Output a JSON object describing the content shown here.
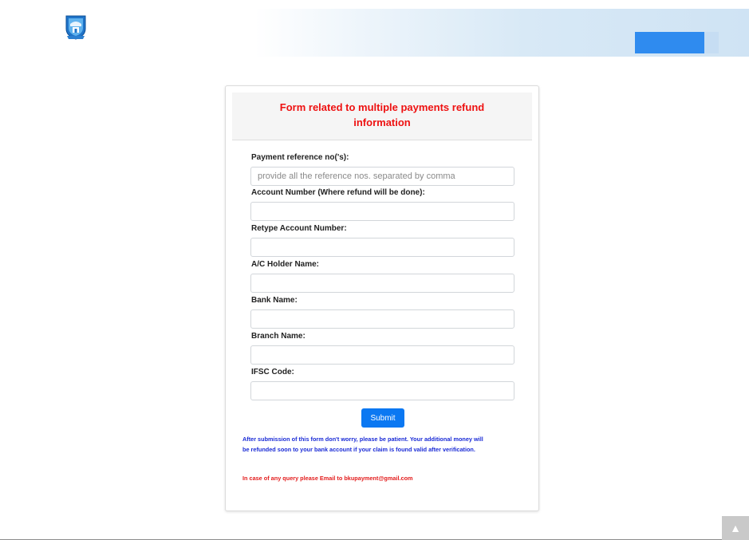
{
  "form": {
    "title_line1": "Form related to multiple payments refund",
    "title_line2": "information",
    "fields": [
      {
        "label": "Payment reference no('s):",
        "placeholder": "provide all the reference nos. separated by comma",
        "value": ""
      },
      {
        "label": "Account Number (Where refund will be done):",
        "placeholder": "",
        "value": ""
      },
      {
        "label": "Retype Account Number:",
        "placeholder": "",
        "value": ""
      },
      {
        "label": "A/C Holder Name:",
        "placeholder": "",
        "value": ""
      },
      {
        "label": "Bank Name:",
        "placeholder": "",
        "value": ""
      },
      {
        "label": "Branch Name:",
        "placeholder": "",
        "value": ""
      },
      {
        "label": "IFSC Code:",
        "placeholder": "",
        "value": ""
      }
    ],
    "submit_label": "Submit",
    "note_line1": "After submission of this form don't worry, please be patient. Your additional money will",
    "note_line2": "be refunded soon to your bank account if your claim is found valid after verification.",
    "query_text": "In case of any query please Email to bkupayment@gmail.com"
  },
  "header": {
    "logo_icon": "university-crest-icon"
  },
  "scroll_top_icon": "arrow-up-icon",
  "colors": {
    "title": "#ee1111",
    "submit": "#0b78f2",
    "note": "#1a2bd6",
    "query": "#e31c1c",
    "header_button": "#2f8bef"
  }
}
